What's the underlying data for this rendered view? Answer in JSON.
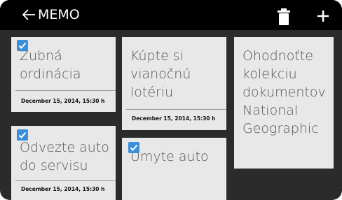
{
  "app": {
    "title": "MEMO"
  },
  "icons": {
    "back": "arrow-left-icon",
    "delete": "trash-icon",
    "add": "plus-icon"
  },
  "colors": {
    "appbar": "#000000",
    "background": "#2b2b2b",
    "card": "#e8e8e8",
    "checkbox": "#3a8fd9"
  },
  "notes": [
    {
      "text_lines": [
        "Zubná",
        "ordinácia"
      ],
      "date": "December 15, 2014, 15:30 h",
      "checked": true
    },
    {
      "text_lines": [
        "Kúpte si",
        "vianočnú",
        "lotériu"
      ],
      "date": "December 15, 2014, 15:30 h",
      "checked": false
    },
    {
      "text_lines": [
        "Ohodnoťte",
        "kolekciu",
        "dokumentov",
        "National",
        "Geographic"
      ],
      "checked": false
    },
    {
      "text_lines": [
        "Odvezte auto",
        "do servisu"
      ],
      "date": "December 15, 2014, 15:30 h",
      "checked": true
    },
    {
      "text_lines": [
        "Umyte auto"
      ],
      "checked": true
    }
  ]
}
